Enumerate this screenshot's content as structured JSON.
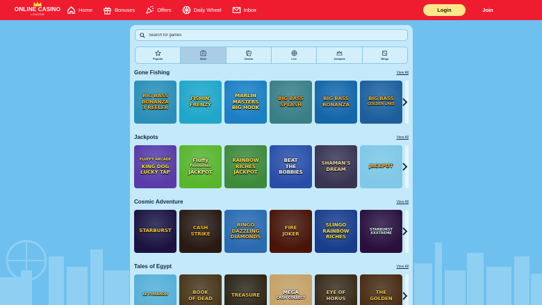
{
  "brand": {
    "name": "ONLINE CASINO",
    "sub": "LONDON"
  },
  "nav": [
    {
      "label": "Home",
      "icon": "home-icon"
    },
    {
      "label": "Bonuses",
      "icon": "gift-icon"
    },
    {
      "label": "Offers",
      "icon": "party-popper-icon"
    },
    {
      "label": "Daily Wheel",
      "icon": "wheel-icon"
    },
    {
      "label": "Inbox",
      "icon": "envelope-icon"
    }
  ],
  "auth": {
    "login": "Login",
    "join": "Join"
  },
  "search": {
    "placeholder": "Search for games"
  },
  "tabs": [
    {
      "label": "Popular",
      "icon": "star-icon"
    },
    {
      "label": "Slots",
      "icon": "slot-machine-icon",
      "active": true
    },
    {
      "label": "Casino",
      "icon": "cards-icon"
    },
    {
      "label": "Live",
      "icon": "roulette-icon"
    },
    {
      "label": "Jackpots",
      "icon": "crown-icon"
    },
    {
      "label": "Bingo",
      "icon": "bingo-icon"
    }
  ],
  "view_all": "View All",
  "sections": [
    {
      "title": "Gone Fishing",
      "games": [
        {
          "lines": [
            "BIG BASS",
            "BONANZA",
            "3 REELER"
          ],
          "bg": "#2a8fb8",
          "fg": "#f5b62a"
        },
        {
          "lines": [
            "FISHIN'",
            "FRENZY"
          ],
          "bg": "#1fa6c9",
          "fg": "#f7d23a"
        },
        {
          "lines": [
            "MARLIN",
            "MASTERS",
            "BIG HOOK"
          ],
          "bg": "#1b7fc4",
          "fg": "#ffe25a"
        },
        {
          "lines": [
            "BIG BASS",
            "SPLASH"
          ],
          "bg": "#3a7e86",
          "fg": "#f1a52a"
        },
        {
          "lines": [
            "BIG BASS",
            "BONANZA"
          ],
          "bg": "#1466a8",
          "fg": "#f4b13a"
        },
        {
          "lines": [
            "BIG BASS",
            "GOLDEN LAKE"
          ],
          "bg": "#1d5f9c",
          "fg": "#f6b52c"
        }
      ]
    },
    {
      "title": "Jackpots",
      "games": [
        {
          "lines": [
            "FLUFFY ARCADE",
            "KING DOG",
            "LUCKY TAP"
          ],
          "bg": "#5a3aa8",
          "fg": "#f2e24a"
        },
        {
          "lines": [
            "Fluffy",
            "Favourites",
            "JACKPOT"
          ],
          "bg": "#58b62a",
          "fg": "#fff3a0"
        },
        {
          "lines": [
            "RAINBOW",
            "RICHES",
            "JACKPOT"
          ],
          "bg": "#3f8a3a",
          "fg": "#ffe04a"
        },
        {
          "lines": [
            "BEAT",
            "THE",
            "BOBBIES"
          ],
          "bg": "#2a4ea8",
          "fg": "#ffffff"
        },
        {
          "lines": [
            "SHAMAN'S",
            "DREAM"
          ],
          "bg": "#3a3452",
          "fg": "#f0d7a0"
        },
        {
          "lines": [
            "JACKPOT"
          ],
          "bg": "#7fc8e6",
          "fg": "#f3a92a"
        }
      ]
    },
    {
      "title": "Cosmic Adventure",
      "games": [
        {
          "lines": [
            "STARBURST"
          ],
          "bg": "#1c1240",
          "fg": "#f6c93a"
        },
        {
          "lines": [
            "CASH",
            "STRIKE"
          ],
          "bg": "#2a1a12",
          "fg": "#f7b82a"
        },
        {
          "lines": [
            "BINGO",
            "DAZZLING",
            "DIAMONDS"
          ],
          "bg": "#2a6ab0",
          "fg": "#f3c33a"
        },
        {
          "lines": [
            "FIRE",
            "JOKER"
          ],
          "bg": "#4a1408",
          "fg": "#f7c23a"
        },
        {
          "lines": [
            "SLINGO",
            "RAINBOW",
            "RICHES"
          ],
          "bg": "#1a3c8c",
          "fg": "#f8e04a"
        },
        {
          "lines": [
            "STARBURST XXXTREME"
          ],
          "bg": "#2a0f3c",
          "fg": "#e0f0ff"
        }
      ]
    },
    {
      "title": "Tales of Egypt",
      "games": [
        {
          "lines": [
            "LE PHARAOH"
          ],
          "bg": "#55b0d8",
          "fg": "#f3c43a"
        },
        {
          "lines": [
            "BOOK",
            "OF DEAD"
          ],
          "bg": "#4a3418",
          "fg": "#f5c24a"
        },
        {
          "lines": [
            "TREASURE"
          ],
          "bg": "#2e2414",
          "fg": "#f2c04a"
        },
        {
          "lines": [
            "MEGA",
            "CASH COLLECT"
          ],
          "bg": "#c9a062",
          "fg": "#ffffff"
        },
        {
          "lines": [
            "EYE OF",
            "HORUS"
          ],
          "bg": "#3a2a18",
          "fg": "#f6d07a"
        },
        {
          "lines": [
            "THE",
            "GOLDEN"
          ],
          "bg": "#4a2a10",
          "fg": "#f5c23a"
        }
      ]
    }
  ],
  "colors": {
    "topbar": "#ee1c2e",
    "background": "#6ec0ee",
    "panel": "#c4e9fb",
    "login": "#fce88a"
  }
}
